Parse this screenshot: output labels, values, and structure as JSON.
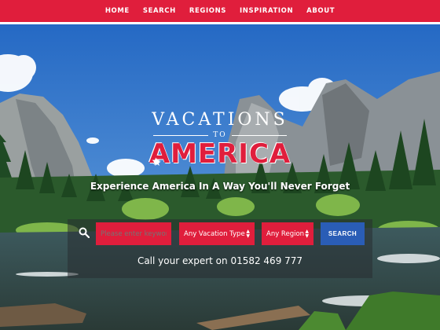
{
  "nav": {
    "items": [
      {
        "label": "HOME"
      },
      {
        "label": "SEARCH"
      },
      {
        "label": "REGIONS"
      },
      {
        "label": "INSPIRATION"
      },
      {
        "label": "ABOUT"
      }
    ]
  },
  "logo": {
    "line1": "VACATIONS",
    "line2": "TO",
    "line3": "AMERICA",
    "star": "★"
  },
  "tagline": "Experience America In A Way You'll Never Forget",
  "search": {
    "keyword_placeholder": "Please enter keyword",
    "vacation_type": "Any Vacation Type",
    "region": "Any Region",
    "button_label": "SEARCH"
  },
  "phone_text": "Call your expert on 01582 469 777",
  "colors": {
    "brand_red": "#e01e3c",
    "search_blue": "#2a5db6"
  }
}
